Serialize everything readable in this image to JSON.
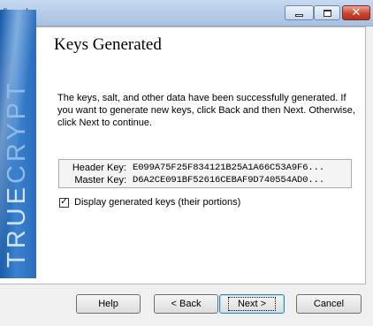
{
  "window": {
    "title": "Vizard",
    "controls": {
      "minimize": "minimize-icon",
      "maximize": "maximize-icon",
      "close": "close-icon"
    }
  },
  "banner": {
    "text_part1": "TRUE",
    "text_part2": "CRYPT"
  },
  "page": {
    "heading": "Keys Generated",
    "info": "The keys, salt, and other data have been successfully generated. If you want to generate new keys, click Back and then Next. Otherwise, click Next to continue."
  },
  "keys": {
    "header_label": "Header Key:",
    "header_value": "E099A75F25F834121B25A1A66C53A9F6...",
    "master_label": "Master Key:",
    "master_value": "D6A2CE091BF52616CEBAF9D740554AD0..."
  },
  "display_checkbox": {
    "checked": true,
    "label": "Display generated keys (their portions)"
  },
  "buttons": {
    "help": "Help",
    "back": "< Back",
    "next": "Next >",
    "cancel": "Cancel"
  },
  "colors": {
    "banner": "#2b6dbd",
    "titlebar": "#b7cde9",
    "close": "#c9452f"
  }
}
